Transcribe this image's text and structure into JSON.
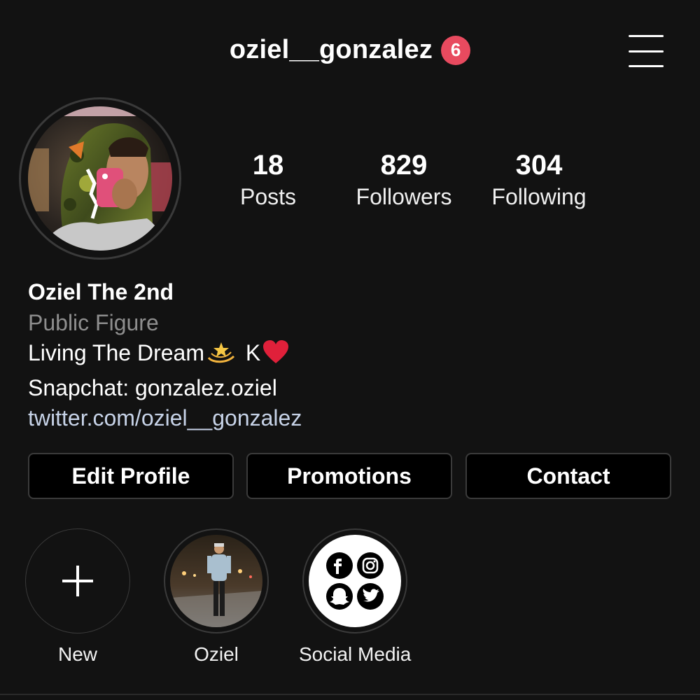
{
  "header": {
    "username": "oziel__gonzalez",
    "notification_count": "6",
    "menu_icon": "hamburger-menu-icon"
  },
  "stats": [
    {
      "value": "18",
      "label": "Posts"
    },
    {
      "value": "829",
      "label": "Followers"
    },
    {
      "value": "304",
      "label": "Following"
    }
  ],
  "bio": {
    "name": "Oziel The 2nd",
    "category": "Public Figure",
    "line1_text": "Living The Dream",
    "line1_suffix": "K",
    "line2": "Snapchat: gonzalez.oziel",
    "link": "twitter.com/oziel__gonzalez"
  },
  "buttons": {
    "edit_profile": "Edit Profile",
    "promotions": "Promotions",
    "contact": "Contact"
  },
  "highlights": [
    {
      "label": "New",
      "icon": "plus-icon"
    },
    {
      "label": "Oziel",
      "icon": "photo"
    },
    {
      "label": "Social Media",
      "icon": "social-icons"
    }
  ],
  "colors": {
    "background": "#121212",
    "badge": "#e84a5f",
    "link": "#c7d3e8",
    "muted": "#8e8e8e"
  }
}
